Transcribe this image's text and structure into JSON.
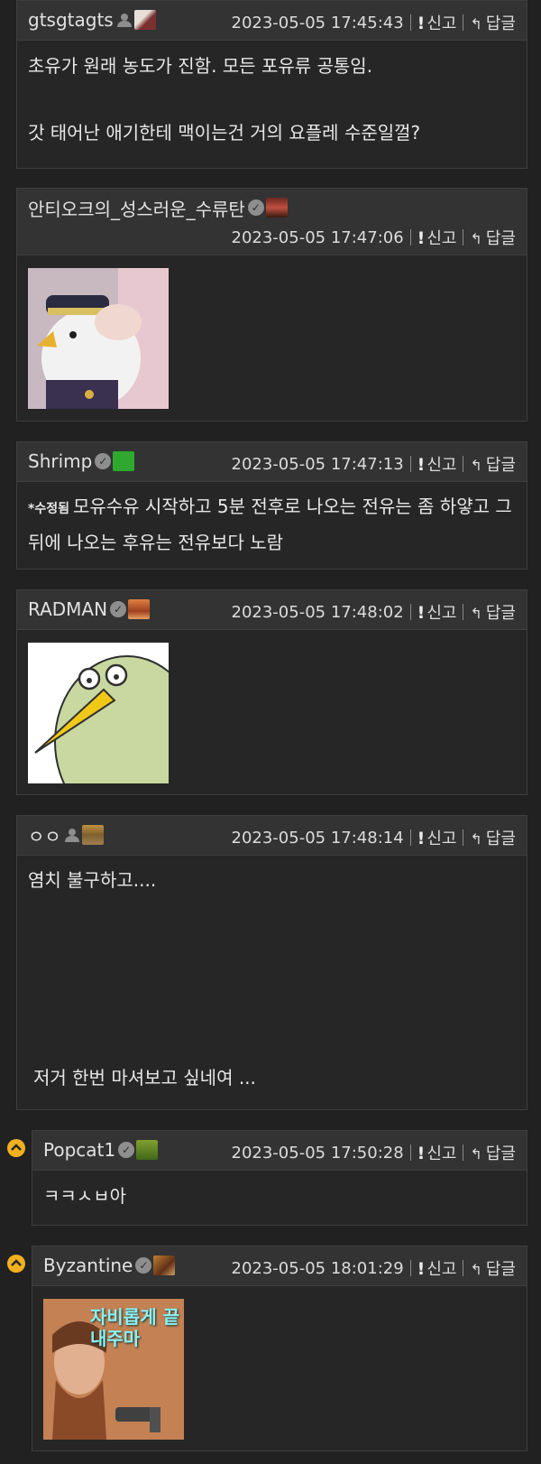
{
  "comments": [
    {
      "user": "gtsgtagts",
      "time": "2023-05-05 17:45:43",
      "report": "신고",
      "reply": "답글",
      "lines": [
        "초유가 원래 농도가 진함. 모든 포유류 공통임.",
        "",
        "갓 태어난 애기한테 맥이는건 거의 요플레 수준일껄?"
      ]
    },
    {
      "user": "안티오크의_성스러운_수류탄",
      "time": "2023-05-05 17:47:06",
      "report": "신고",
      "reply": "답글"
    },
    {
      "user": "Shrimp",
      "time": "2023-05-05 17:47:13",
      "report": "신고",
      "reply": "답글",
      "edited": "*수정됨",
      "text": "모유수유 시작하고 5분 전후로 나오는 전유는 좀 하얗고 그 뒤에 나오는 후유는 전유보다 노람"
    },
    {
      "user": "RADMAN",
      "time": "2023-05-05 17:48:02",
      "report": "신고",
      "reply": "답글"
    },
    {
      "user": "ㅇㅇ",
      "time": "2023-05-05 17:48:14",
      "report": "신고",
      "reply": "답글",
      "text1": "염치 불구하고....",
      "text2": "저거 한번 마셔보고 싶네여 ..."
    },
    {
      "user": "Popcat1",
      "time": "2023-05-05 17:50:28",
      "report": "신고",
      "reply": "답글",
      "text": "ㅋㅋㅅㅂ아"
    },
    {
      "user": "Byzantine",
      "time": "2023-05-05 18:01:29",
      "report": "신고",
      "reply": "답글",
      "image_caption": "자비롭게 끝내주마"
    }
  ],
  "colors": {
    "bg": "#212121",
    "header": "#333333",
    "reply_indicator": "#f0b020"
  }
}
